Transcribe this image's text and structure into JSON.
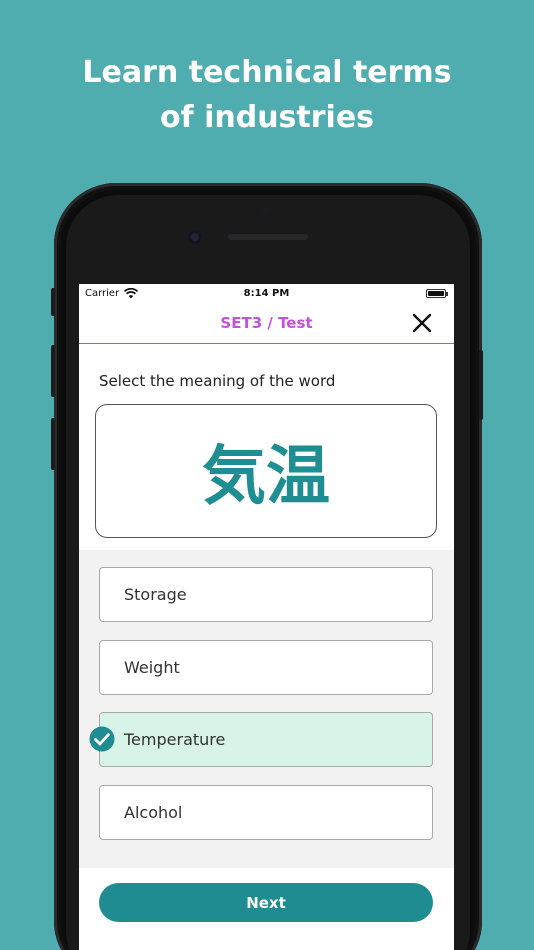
{
  "headline": {
    "line1": "Learn technical terms",
    "line2": "of industries"
  },
  "status_bar": {
    "carrier": "Carrier",
    "time": "8:14 PM",
    "wifi_icon": "wifi-icon",
    "battery_icon": "battery-icon"
  },
  "nav": {
    "title": "SET3 / Test",
    "close_icon": "close-icon"
  },
  "quiz": {
    "prompt": "Select the meaning of the word",
    "word": "気温",
    "options": [
      {
        "label": "Storage",
        "selected": false
      },
      {
        "label": "Weight",
        "selected": false
      },
      {
        "label": "Temperature",
        "selected": true
      },
      {
        "label": "Alcohol",
        "selected": false
      }
    ],
    "next_label": "Next"
  },
  "colors": {
    "background": "#4fadb0",
    "accent_purple": "#c54fdf",
    "accent_teal": "#1f8c91",
    "selected_option": "#d8f3e8"
  }
}
